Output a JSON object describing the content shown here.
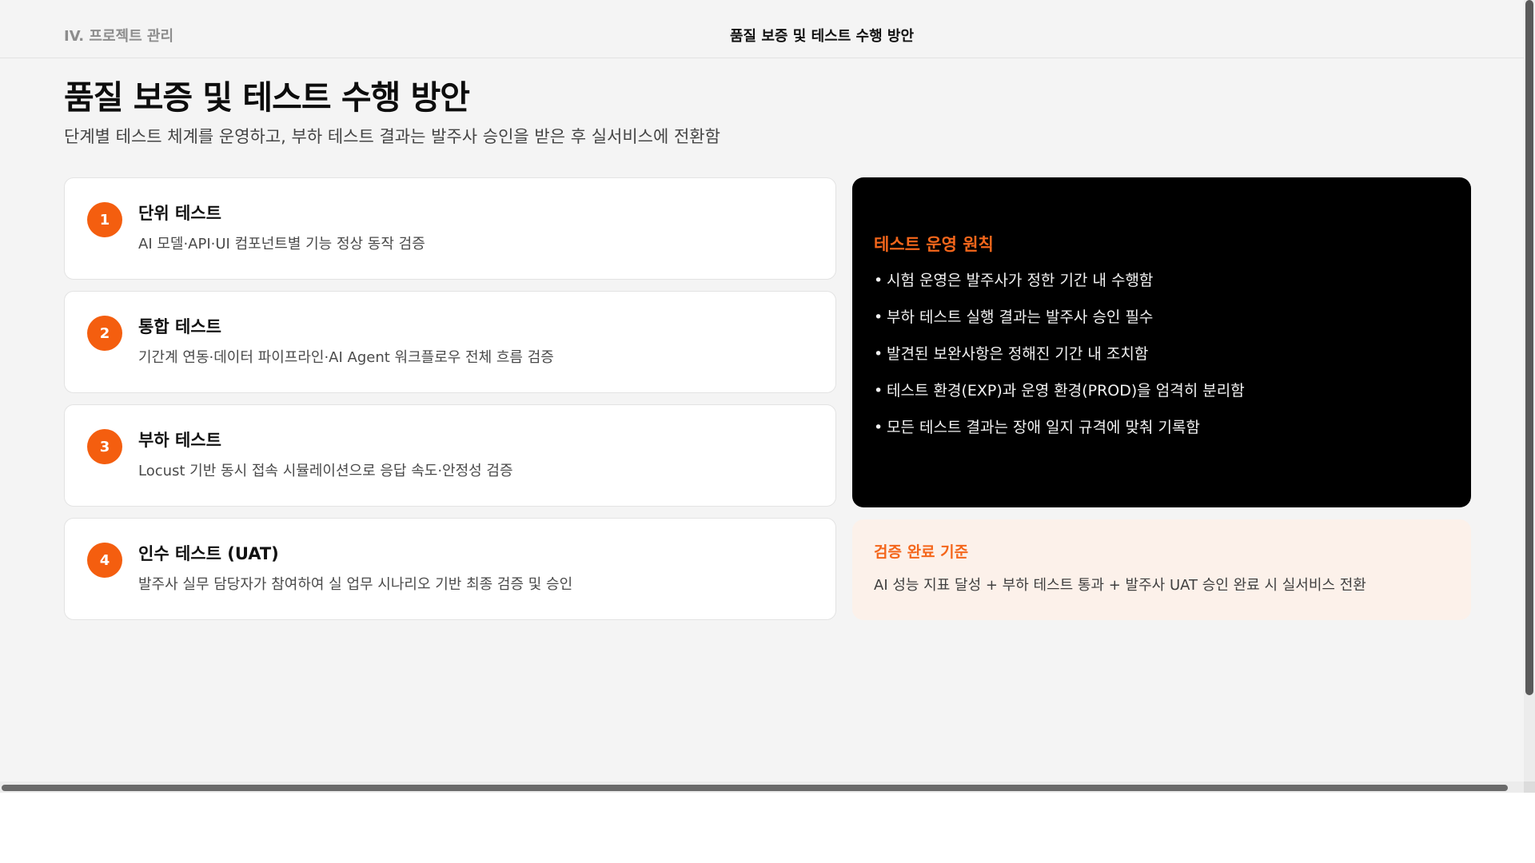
{
  "header": {
    "section_label": "IV. 프로젝트 관리",
    "title": "품질 보증 및 테스트 수행 방안"
  },
  "page": {
    "title": "품질 보증 및 테스트 수행 방안",
    "subtitle": "단계별 테스트 체계를 운영하고, 부하 테스트 결과는 발주사 승인을 받은 후 실서비스에 전환함"
  },
  "steps": [
    {
      "number": "1",
      "title": "단위 테스트",
      "description": "AI 모델·API·UI 컴포넌트별 기능 정상 동작 검증"
    },
    {
      "number": "2",
      "title": "통합 테스트",
      "description": "기간계 연동·데이터 파이프라인·AI Agent 워크플로우 전체 흐름 검증"
    },
    {
      "number": "3",
      "title": "부하 테스트",
      "description": "Locust 기반 동시 접속 시뮬레이션으로 응답 속도·안정성 검증"
    },
    {
      "number": "4",
      "title": "인수 테스트 (UAT)",
      "description": "발주사 실무 담당자가 참여하여 실 업무 시나리오 기반 최종 검증 및 승인"
    }
  ],
  "principles": {
    "title": "테스트 운영 원칙",
    "bullet": "•",
    "items": [
      "시험 운영은 발주사가 정한 기간 내 수행함",
      "부하 테스트 실행 결과는 발주사 승인 필수",
      "발견된 보완사항은 정해진 기간 내 조치함",
      "테스트 환경(EXP)과 운영 환경(PROD)을 엄격히 분리함",
      "모든 테스트 결과는 장애 일지 규격에 맞춰 기록함"
    ]
  },
  "criteria": {
    "title": "검증 완료 기준",
    "description": "AI 성능 지표 달성 + 부하 테스트 통과 + 발주사 UAT 승인 완료 시 실서비스 전환"
  },
  "colors": {
    "accent": "#f45e0f",
    "dark_panel": "#000000",
    "criteria_bg": "#fcf1ea",
    "page_bg": "#f4f4f4"
  }
}
